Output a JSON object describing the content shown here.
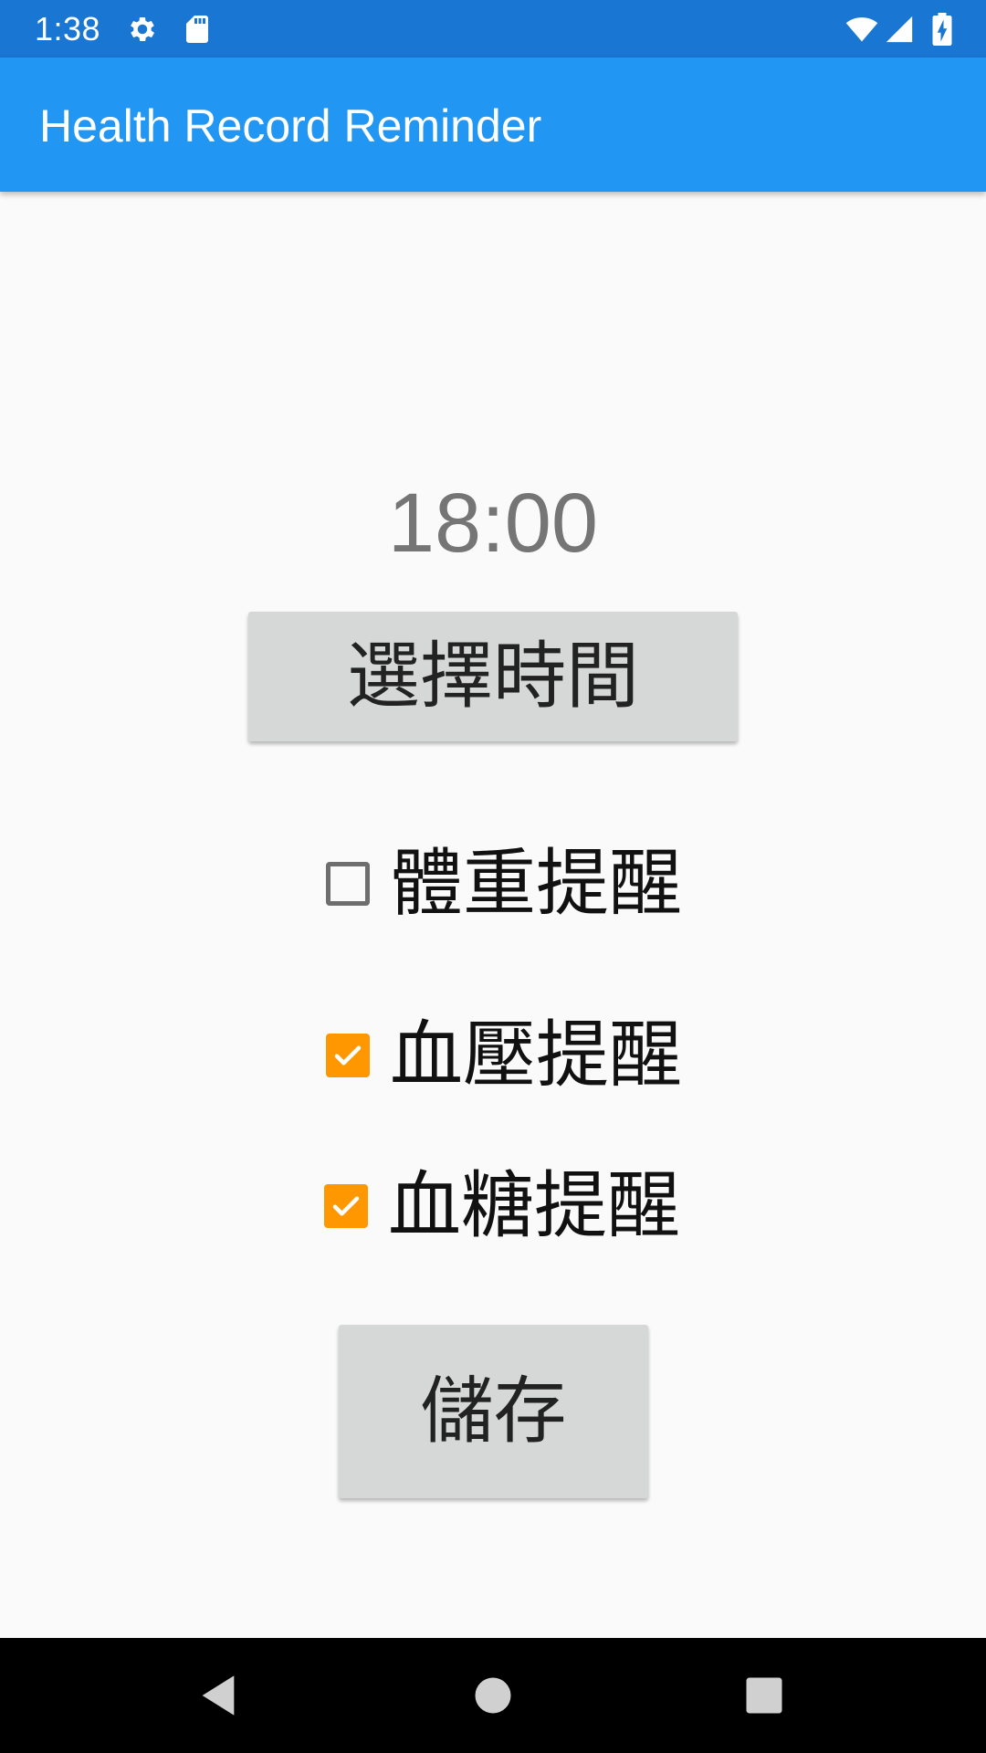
{
  "status_bar": {
    "time": "1:38",
    "icons": [
      "gear-icon",
      "sd-card-icon",
      "wifi-icon",
      "cell-signal-icon",
      "battery-charging-icon"
    ]
  },
  "app_bar": {
    "title": "Health Record Reminder",
    "color": "#2196F3"
  },
  "main": {
    "time_value": "18:00",
    "select_time_button": "選擇時間",
    "reminders": [
      {
        "label": "體重提醒",
        "checked": false
      },
      {
        "label": "血壓提醒",
        "checked": true
      },
      {
        "label": "血糖提醒",
        "checked": true
      }
    ],
    "save_button": "儲存",
    "accent_color": "#FF9800"
  },
  "nav_bar": {
    "buttons": [
      "back-icon",
      "home-icon",
      "recents-icon"
    ]
  }
}
